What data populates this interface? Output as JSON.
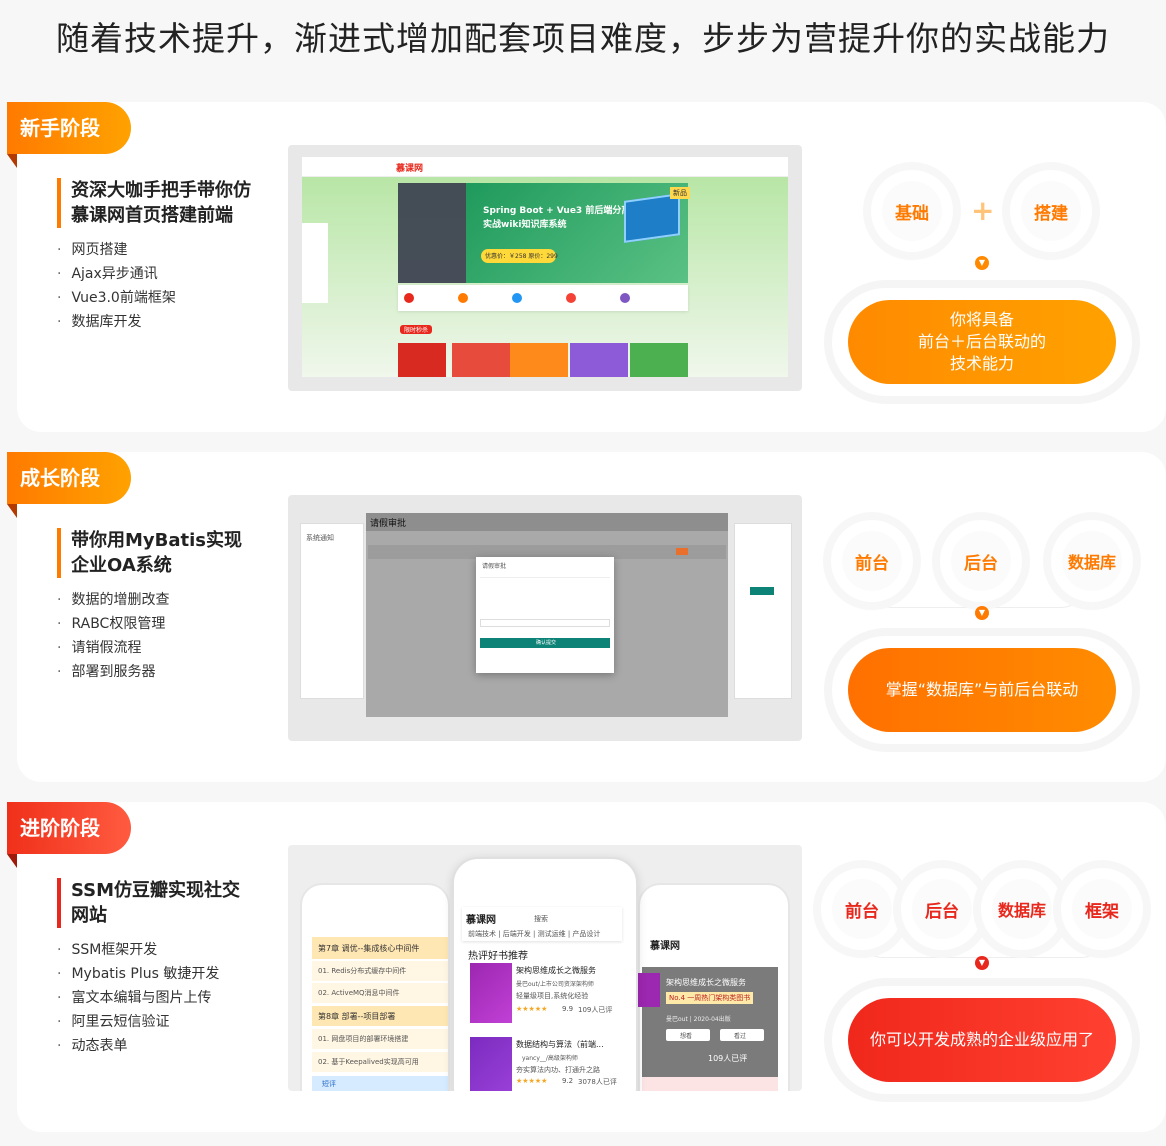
{
  "headline": "随着技术提升，渐进式增加配套项目难度，步步为营提升你的实战能力",
  "stages": [
    {
      "tag": "新手阶段",
      "title": "资深大咖手把手带你仿慕课网首页搭建前端",
      "bullets": [
        "网页搭建",
        "Ajax异步通讯",
        "Vue3.0前端框架",
        "数据库开发"
      ],
      "badges": [
        "基础",
        "搭建"
      ],
      "plus": "+",
      "result": [
        "你将具备",
        "前台＋后台联动的",
        "技术能力"
      ],
      "shot": {
        "logo": "慕课网",
        "banner_title": "Spring Boot + Vue3 前后端分离",
        "banner_sub": "实战wiki知识库系统",
        "banner_price": "优惠价：￥258  原价：299",
        "hot": "限时秒杀",
        "label": "新品"
      }
    },
    {
      "tag": "成长阶段",
      "title": "带你用MyBatis实现企业OA系统",
      "bullets": [
        "数据的增删改查",
        "RABC权限管理",
        "请销假流程",
        "部署到服务器"
      ],
      "badges": [
        "前台",
        "后台",
        "数据库"
      ],
      "result": [
        "掌握“数据库”与前后台联动"
      ],
      "shot": {
        "window_title": "请假审批",
        "side_title": "系统通知",
        "dialog_title": "请假审批",
        "submit": "确认提交"
      }
    },
    {
      "tag": "进阶阶段",
      "title": "SSM仿豆瓣实现社交网站",
      "bullets": [
        "SSM框架开发",
        "Mybatis Plus 敏捷开发",
        "富文本编辑与图片上传",
        "阿里云短信验证",
        "动态表单"
      ],
      "badges": [
        "前台",
        "后台",
        "数据库",
        "框架"
      ],
      "result": [
        "你可以开发成熟的企业级应用了"
      ],
      "shot": {
        "chapter7": "第7章 调优--集成核心中间件",
        "item1": "01. Redis分布式缓存中间件",
        "item2": "02. ActiveMQ消息中间件",
        "chapter8": "第8章 部署--项目部署",
        "item3": "01. 网盘项目的部署环境搭建",
        "item4": "02. 基于Keepalived实现高可用",
        "short": "短评",
        "logo": "慕课网",
        "search": "搜索",
        "nav": "前端技术 | 后端开发 | 测试运维 | 产品设计",
        "hot_books": "热评好书推荐",
        "book1": "架构思维成长之微服务",
        "book1_author": "曼巴out/上市公司资深架构师",
        "book1_desc": "轻量级项目,系统化经验",
        "book1_rate": "9.9",
        "book1_count": "109人已评",
        "book2": "数据结构与算法（前端...",
        "book2_author": "yancy__/高级架构师",
        "book2_desc": "夯实算法内功、打通升之路",
        "book2_rate": "9.2",
        "book2_count": "3078人已评",
        "right_book": "架构思维成长之微服务",
        "right_rank": "No.4 一周热门架构类图书",
        "right_meta": "曼巴out | 2020-04出版",
        "right_want": "想看",
        "right_seen": "看过",
        "right_count": "109人已评"
      }
    }
  ]
}
